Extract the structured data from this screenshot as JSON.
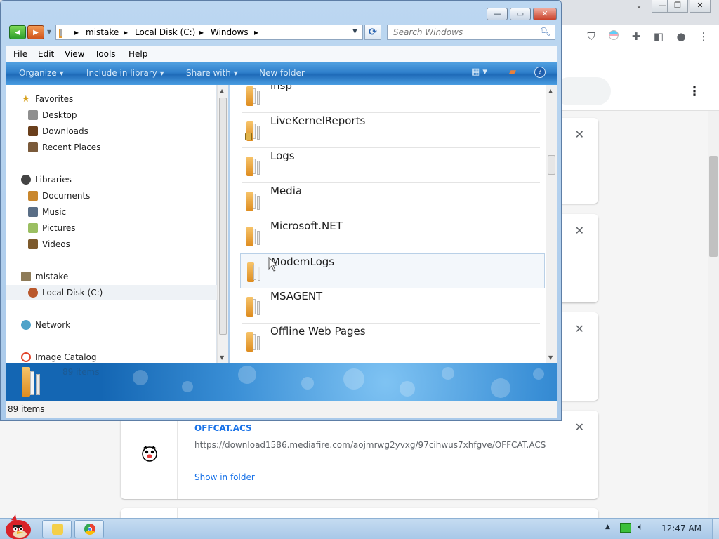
{
  "chrome": {
    "titlebar_buttons": {
      "chevron": "⌄",
      "min": "—",
      "restore": "❐",
      "close": "✕"
    },
    "toolbar_icons": [
      "ublock-icon",
      "pride-extension-icon",
      "puzzle-extensions-icon",
      "side-panel-icon",
      "profile-icon",
      "menu-kebab-icon"
    ],
    "downloads": [
      {
        "filename": "",
        "url": "",
        "action": "",
        "close": "✕"
      },
      {
        "filename": "",
        "url": "",
        "action": "",
        "close": "✕"
      },
      {
        "filename": "",
        "url": "",
        "action": "",
        "close": "✕"
      },
      {
        "filename": "OFFCAT.ACS",
        "url": "https://download1586.mediafire.com/aojmrwg2yvxg/97cihwus7xhfgve/OFFCAT.ACS",
        "action": "Show in folder",
        "close": "✕"
      }
    ]
  },
  "explorer": {
    "caption": {
      "min": "—",
      "max": "▭",
      "close": "✕"
    },
    "breadcrumb": [
      "mistake",
      "Local Disk (C:)",
      "Windows"
    ],
    "search_placeholder": "Search Windows",
    "menu": [
      "File",
      "Edit",
      "View",
      "Tools",
      "Help"
    ],
    "commands": [
      "Organize",
      "Include in library",
      "Share with",
      "New folder"
    ],
    "nav": {
      "favorites": {
        "label": "Favorites",
        "items": [
          "Desktop",
          "Downloads",
          "Recent Places"
        ]
      },
      "libraries": {
        "label": "Libraries",
        "items": [
          "Documents",
          "Music",
          "Pictures",
          "Videos"
        ]
      },
      "computer": {
        "label": "mistake",
        "items": [
          "Local Disk (C:)"
        ]
      },
      "network": "Network",
      "image_catalog": "Image Catalog"
    },
    "files": [
      "lhsp",
      "LiveKernelReports",
      "Logs",
      "Media",
      "Microsoft.NET",
      "ModemLogs",
      "MSAGENT",
      "Offline Web Pages"
    ],
    "details_count": "89 items",
    "status": "89 items",
    "colors": {
      "command_bar": "#2f7fcb",
      "folder": "#f0a63a"
    }
  },
  "taskbar": {
    "clock": "12:47 AM"
  }
}
